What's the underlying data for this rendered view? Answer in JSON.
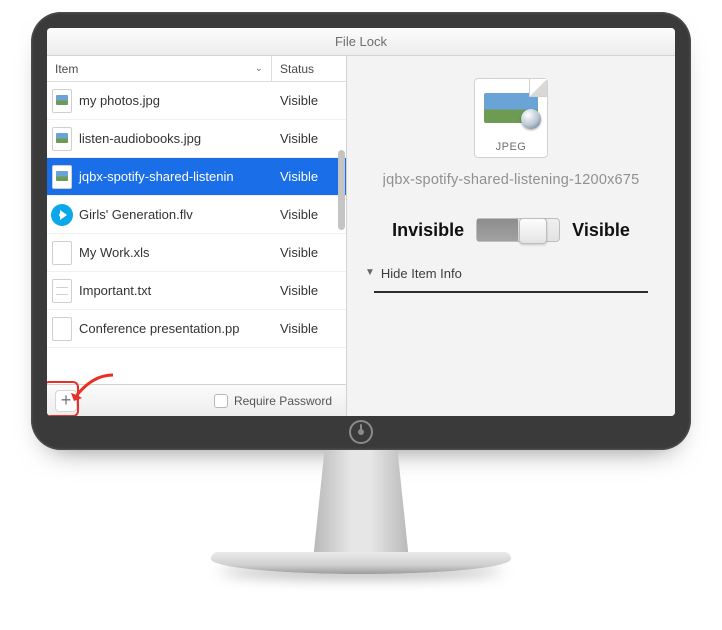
{
  "window": {
    "title": "File Lock"
  },
  "columns": {
    "item": "Item",
    "status": "Status"
  },
  "rows": [
    {
      "name": "my photos.jpg",
      "status": "Visible",
      "icon": "jpeg",
      "selected": false
    },
    {
      "name": "listen-audiobooks.jpg",
      "status": "Visible",
      "icon": "jpeg",
      "selected": false
    },
    {
      "name": "jqbx-spotify-shared-listenin",
      "status": "Visible",
      "icon": "jpeg",
      "selected": true
    },
    {
      "name": "Girls' Generation.flv",
      "status": "Visible",
      "icon": "flv",
      "selected": false
    },
    {
      "name": "My Work.xls",
      "status": "Visible",
      "icon": "blank",
      "selected": false
    },
    {
      "name": "Important.txt",
      "status": "Visible",
      "icon": "txt",
      "selected": false
    },
    {
      "name": "Conference presentation.pp",
      "status": "Visible",
      "icon": "blank",
      "selected": false
    }
  ],
  "footer": {
    "require_password": "Require Password"
  },
  "detail": {
    "icon_label": "JPEG",
    "filename": "jqbx-spotify-shared-listening-1200x675",
    "invisible": "Invisible",
    "visible": "Visible",
    "disclosure": "Hide Item Info"
  }
}
